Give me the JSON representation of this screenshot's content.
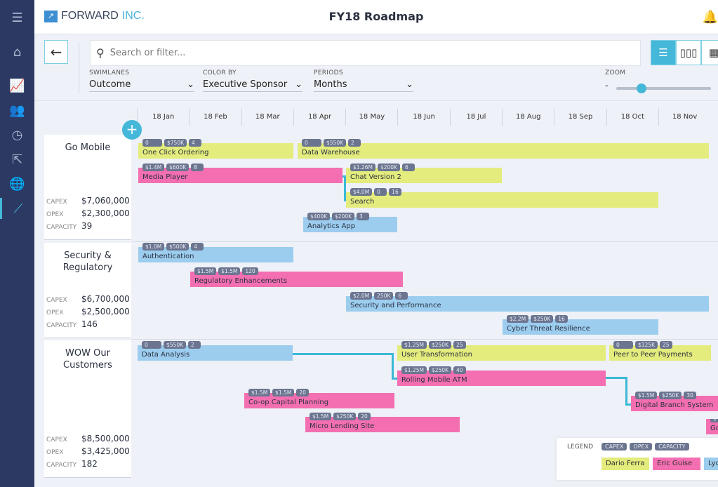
{
  "app": {
    "logo_main": "FORWARD",
    "logo_suffix": "INC.",
    "title": "FY18 Roadmap"
  },
  "colors": {
    "nav": "#2c3a63",
    "accent": "#45b7d9",
    "dario": "#e3ec7c",
    "eric": "#f46fb1",
    "lydia": "#9ccdef"
  },
  "nav": [
    "menu-icon",
    "home-icon",
    "chart-icon",
    "users-icon",
    "clock-icon",
    "export-icon",
    "globe-icon",
    "roadmap-icon"
  ],
  "toolbar": {
    "search_placeholder": "Search or filter...",
    "swimlanes": {
      "label": "SWIMLANES",
      "value": "Outcome"
    },
    "color_by": {
      "label": "COLOR BY",
      "value": "Executive Sponsor"
    },
    "periods": {
      "label": "PERIODS",
      "value": "Months"
    },
    "zoom": {
      "label": "ZOOM",
      "minus": "-",
      "level": 0.27
    },
    "views": [
      "gantt",
      "columns",
      "grid"
    ]
  },
  "months": [
    "18 Jan",
    "18 Feb",
    "18 Mar",
    "18 Apr",
    "18 May",
    "18 Jun",
    "18 Jul",
    "18 Aug",
    "18 Sep",
    "18 Oct",
    "18 Nov"
  ],
  "stat_labels": {
    "capex": "CAPEX",
    "opex": "OPEX",
    "capacity": "CAPACITY"
  },
  "lanes": [
    {
      "name": "Go Mobile",
      "capex": "$7,060,000",
      "opex": "$2,300,000",
      "capacity": "39"
    },
    {
      "name": "Security & Regulatory",
      "capex": "$6,700,000",
      "opex": "$2,500,000",
      "capacity": "146"
    },
    {
      "name": "WOW Our Customers",
      "capex": "$8,500,000",
      "opex": "$3,425,000",
      "capacity": "182"
    }
  ],
  "items": [
    {
      "name": "One Click Ordering",
      "sponsor": "dario",
      "capex": "0",
      "opex": "$750K",
      "capacity": "4"
    },
    {
      "name": "Data Warehouse",
      "sponsor": "dario",
      "capex": "0",
      "opex": "$550K",
      "capacity": "2"
    },
    {
      "name": "Media Player",
      "sponsor": "eric",
      "capex": "$1.4M",
      "opex": "$600K",
      "capacity": "8"
    },
    {
      "name": "Chat Version 2",
      "sponsor": "dario",
      "capex": "$1.26M",
      "opex": "$200K",
      "capacity": "6"
    },
    {
      "name": "Search",
      "sponsor": "dario",
      "capex": "$4.0M",
      "opex": "0",
      "capacity": "16"
    },
    {
      "name": "Analytics App",
      "sponsor": "lydia",
      "capex": "$400K",
      "opex": "$200K",
      "capacity": "3"
    },
    {
      "name": "Authentication",
      "sponsor": "lydia",
      "capex": "$1.0M",
      "opex": "$500K",
      "capacity": "4"
    },
    {
      "name": "Regulatory Enhancements",
      "sponsor": "eric",
      "capex": "$1.5M",
      "opex": "$1.5M",
      "capacity": "120"
    },
    {
      "name": "Security and Performance",
      "sponsor": "lydia",
      "capex": "$2.0M",
      "opex": "250K",
      "capacity": "6"
    },
    {
      "name": "Cyber Threat Resilience",
      "sponsor": "lydia",
      "capex": "$2.2M",
      "opex": "$250K",
      "capacity": "16"
    },
    {
      "name": "Data Analysis",
      "sponsor": "lydia",
      "capex": "0",
      "opex": "$550K",
      "capacity": "2"
    },
    {
      "name": "User Transformation",
      "sponsor": "dario",
      "capex": "$1.25M",
      "opex": "$250K",
      "capacity": "25"
    },
    {
      "name": "Peer to Peer Payments",
      "sponsor": "dario",
      "capex": "0",
      "opex": "$125K",
      "capacity": "25"
    },
    {
      "name": "Rolling Mobile ATM",
      "sponsor": "eric",
      "capex": "$1.25M",
      "opex": "$250K",
      "capacity": "40"
    },
    {
      "name": "Digital Branch System",
      "sponsor": "eric",
      "capex": "$1.5M",
      "opex": "$250K",
      "capacity": "30"
    },
    {
      "name": "Co-op Capital Planning",
      "sponsor": "eric",
      "capex": "$1.5M",
      "opex": "$1.5M",
      "capacity": "20"
    },
    {
      "name": "Micro Lending Site",
      "sponsor": "eric",
      "capex": "$1.5M",
      "opex": "$250K",
      "capacity": "20"
    },
    {
      "name": "Go",
      "sponsor": "eric",
      "capex": "$",
      "opex": "",
      "capacity": ""
    }
  ],
  "legend": {
    "title": "LEGEND",
    "badges": [
      "CAPEX",
      "OPEX",
      "CAPACITY"
    ],
    "sponsors": [
      "Dario Ferra",
      "Eric Guise",
      "Lydi"
    ]
  }
}
